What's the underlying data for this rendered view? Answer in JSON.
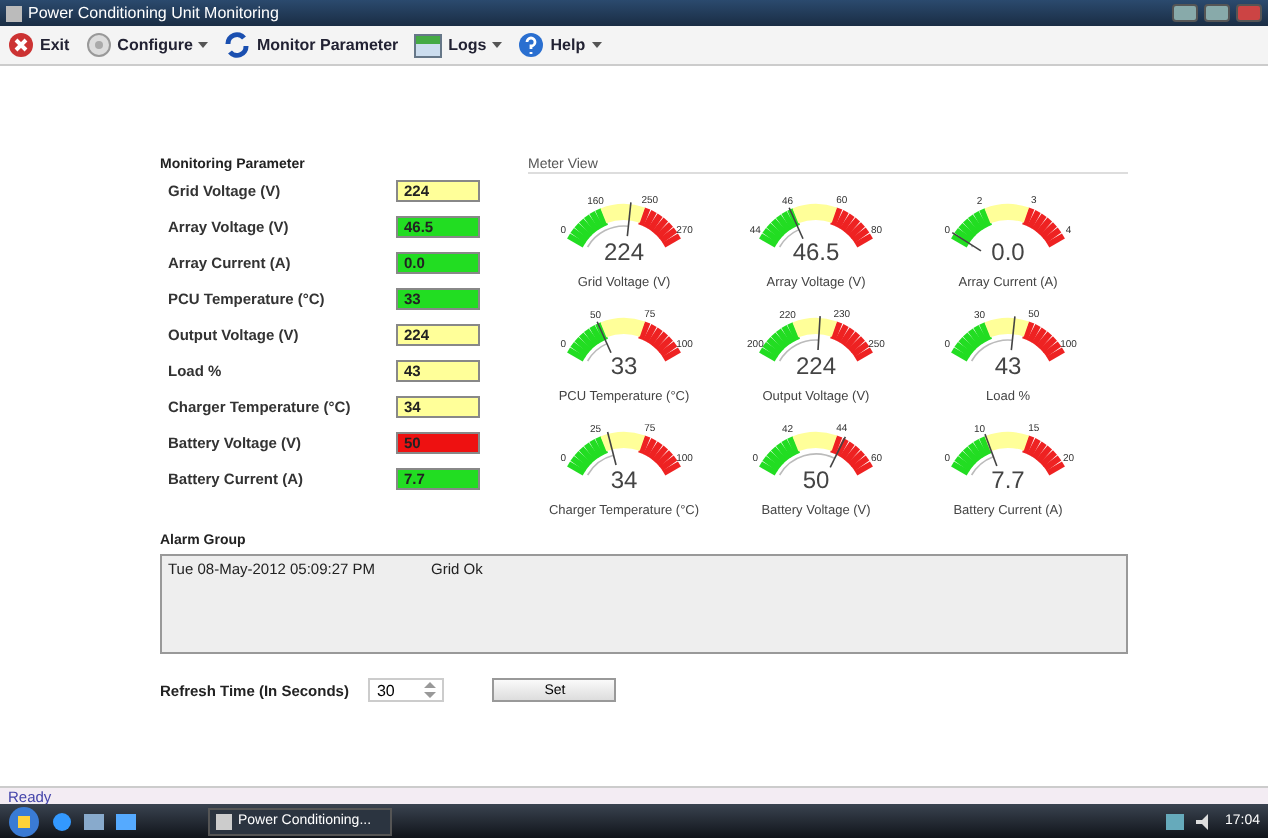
{
  "window": {
    "title": "Power Conditioning Unit Monitoring"
  },
  "toolbar": [
    {
      "label": "Exit",
      "kind": "exit",
      "dropdown": false
    },
    {
      "label": "Configure",
      "kind": "configure",
      "dropdown": true
    },
    {
      "label": "Monitor Parameter",
      "kind": "monitor",
      "dropdown": false
    },
    {
      "label": "Logs",
      "kind": "logs",
      "dropdown": true
    },
    {
      "label": "Help",
      "kind": "help",
      "dropdown": true
    }
  ],
  "monitoring": {
    "title": "Monitoring Parameter",
    "parameters": [
      {
        "label": "Grid Voltage (V)",
        "value": "224",
        "color": "#ffff99"
      },
      {
        "label": "Array Voltage (V)",
        "value": "46.5",
        "color": "#22dd22"
      },
      {
        "label": "Array Current (A)",
        "value": "0.0",
        "color": "#22dd22"
      },
      {
        "label": "PCU Temperature (°C)",
        "value": "33",
        "color": "#22dd22"
      },
      {
        "label": "Output Voltage (V)",
        "value": "224",
        "color": "#ffff99"
      },
      {
        "label": "Load %",
        "value": "43",
        "color": "#ffff99"
      },
      {
        "label": "Charger Temperature (°C)",
        "value": "34",
        "color": "#ffff99"
      },
      {
        "label": "Battery Voltage (V)",
        "value": "50",
        "color": "#ee1111"
      },
      {
        "label": "Battery Current (A)",
        "value": "7.7",
        "color": "#22dd22"
      }
    ]
  },
  "meter_view": {
    "title": "Meter View",
    "meters": [
      {
        "label": "Grid Voltage (V)",
        "reading": "224",
        "ticks": [
          "0",
          "160",
          "250",
          "270"
        ],
        "level": 0.55
      },
      {
        "label": "Array Voltage (V)",
        "reading": "46.5",
        "ticks": [
          "44",
          "46",
          "60",
          "80"
        ],
        "level": 0.3
      },
      {
        "label": "Array Current (A)",
        "reading": "0.0",
        "ticks": [
          "0",
          "2",
          "3",
          "4"
        ],
        "level": 0.02
      },
      {
        "label": "PCU Temperature (°C)",
        "reading": "33",
        "ticks": [
          "0",
          "50",
          "75",
          "100"
        ],
        "level": 0.3
      },
      {
        "label": "Output Voltage (V)",
        "reading": "224",
        "ticks": [
          "200",
          "220",
          "230",
          "250"
        ],
        "level": 0.53
      },
      {
        "label": "Load %",
        "reading": "43",
        "ticks": [
          "0",
          "30",
          "50",
          "100"
        ],
        "level": 0.55
      },
      {
        "label": "Charger Temperature (°C)",
        "reading": "34",
        "ticks": [
          "0",
          "25",
          "75",
          "100"
        ],
        "level": 0.38
      },
      {
        "label": "Battery Voltage (V)",
        "reading": "50",
        "ticks": [
          "0",
          "42",
          "44",
          "60"
        ],
        "level": 0.72
      },
      {
        "label": "Battery Current (A)",
        "reading": "7.7",
        "ticks": [
          "0",
          "10",
          "15",
          "20"
        ],
        "level": 0.33
      }
    ]
  },
  "alarm_group": {
    "title": "Alarm Group",
    "entries": [
      {
        "time": "Tue 08-May-2012 05:09:27 PM",
        "message": "Grid Ok"
      }
    ]
  },
  "refresh": {
    "label": "Refresh Time (In Seconds)",
    "value": "30",
    "button": "Set"
  },
  "status_bar": {
    "text": "Ready"
  },
  "taskbar": {
    "task": "Power Conditioning...",
    "clock": "17:04"
  }
}
